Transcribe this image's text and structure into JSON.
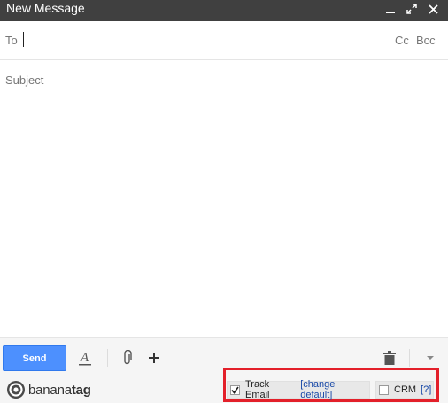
{
  "window": {
    "title": "New Message"
  },
  "to": {
    "label": "To",
    "value": "",
    "cc_label": "Cc",
    "bcc_label": "Bcc"
  },
  "subject": {
    "placeholder": "Subject",
    "value": ""
  },
  "toolbar": {
    "send_label": "Send",
    "icons": [
      "format-text-icon",
      "attach-icon",
      "plus-icon",
      "trash-icon",
      "more-options-icon"
    ]
  },
  "bananatag": {
    "logo_text_light": "banana",
    "logo_text_bold": "tag",
    "track_email_label": "Track Email",
    "track_email_checked": true,
    "change_default_link": "[change default]",
    "crm_label": "CRM",
    "crm_checked": false,
    "help_link": "[?]"
  },
  "colors": {
    "titlebar": "#404040",
    "send_button": "#4d90fe",
    "highlight": "#e3202a",
    "link": "#1a4aa8"
  }
}
